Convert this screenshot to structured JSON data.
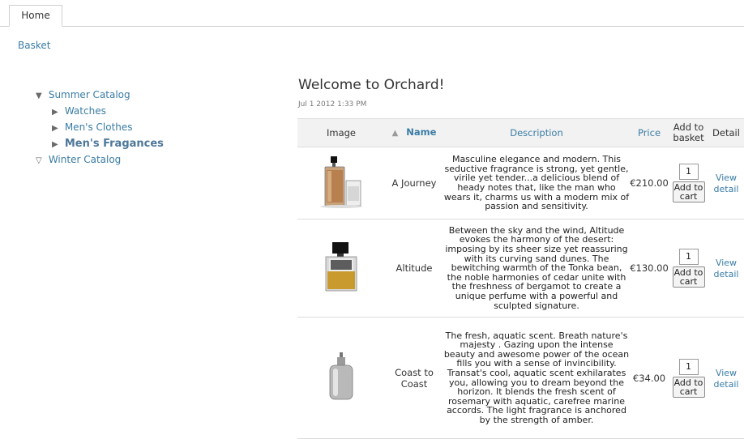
{
  "tabs": [
    {
      "label": "Home"
    }
  ],
  "basket_link": "Basket",
  "catalog": {
    "summer": {
      "label": "Summer Catalog",
      "items": [
        {
          "label": "Watches"
        },
        {
          "label": "Men's Clothes"
        },
        {
          "label": "Men's Fragances"
        }
      ]
    },
    "winter": {
      "label": "Winter Catalog"
    }
  },
  "main": {
    "title": "Welcome to Orchard!",
    "date": "Jul 1 2012 1:33 PM"
  },
  "table": {
    "headers": {
      "image": "Image",
      "name": "Name",
      "description": "Description",
      "price": "Price",
      "add_to_basket": "Add to basket",
      "detail": "Detail"
    },
    "add_to_cart_label": "Add to cart",
    "view_detail_label": "View detail",
    "rows": [
      {
        "name": "A Journey",
        "description": "Masculine elegance and modern. This seductive fragrance is strong, yet gentle, virile yet tender...a delicious blend of heady notes that, like the man who wears it, charms us with a modern mix of passion and sensitivity.",
        "price": "€210.00",
        "quantity": "1"
      },
      {
        "name": "Altitude",
        "description": "Between the sky and the wind, Altitude evokes the harmony of the desert: imposing by its sheer size yet reassuring with its curving sand dunes. The bewitching warmth of the Tonka bean, the noble harmonies of cedar unite with the freshness of bergamot to create a unique perfume with a powerful and sculpted signature.",
        "price": "€130.00",
        "quantity": "1"
      },
      {
        "name": "Coast to Coast",
        "description": "The fresh, aquatic scent. Breath nature's majesty . Gazing upon the intense beauty and awesome power of the ocean fills you with a sense of invincibility. Transat's cool, aquatic scent exhilarates you, allowing you to dream beyond the horizon. It blends the fresh scent of rosemary with aquatic, carefree marine accords. The light fragrance is anchored by the strength of amber.",
        "price": "€34.00",
        "quantity": "1"
      }
    ]
  },
  "colors": {
    "link": "#3a7ca5",
    "header_bg": "#f2f2f2",
    "border": "#dcdcdc"
  }
}
